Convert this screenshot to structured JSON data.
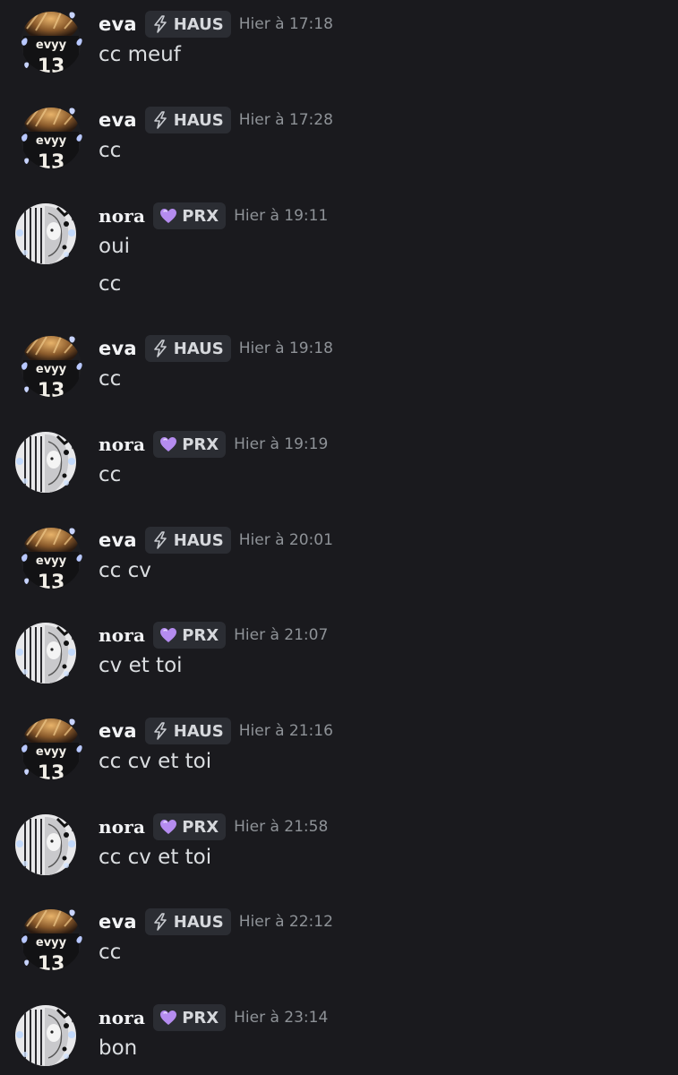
{
  "messages": [
    {
      "author": "eva",
      "avatar": "eva-avatar",
      "tag_icon": "lightning-icon",
      "tag": "HAUS",
      "time": "Hier à 17:18",
      "lines": [
        "cc meuf"
      ]
    },
    {
      "author": "eva",
      "avatar": "eva-avatar",
      "tag_icon": "lightning-icon",
      "tag": "HAUS",
      "time": "Hier à 17:28",
      "lines": [
        "cc"
      ]
    },
    {
      "author": "nora",
      "avatar": "nora-avatar",
      "tag_icon": "purple-heart-icon",
      "tag": "PRX",
      "time": "Hier à 19:11",
      "lines": [
        "oui",
        "cc"
      ]
    },
    {
      "author": "eva",
      "avatar": "eva-avatar",
      "tag_icon": "lightning-icon",
      "tag": "HAUS",
      "time": "Hier à 19:18",
      "lines": [
        "cc"
      ]
    },
    {
      "author": "nora",
      "avatar": "nora-avatar",
      "tag_icon": "purple-heart-icon",
      "tag": "PRX",
      "time": "Hier à 19:19",
      "lines": [
        "cc"
      ]
    },
    {
      "author": "eva",
      "avatar": "eva-avatar",
      "tag_icon": "lightning-icon",
      "tag": "HAUS",
      "time": "Hier à 20:01",
      "lines": [
        "cc cv"
      ]
    },
    {
      "author": "nora",
      "avatar": "nora-avatar",
      "tag_icon": "purple-heart-icon",
      "tag": "PRX",
      "time": "Hier à 21:07",
      "lines": [
        "cv et toi"
      ]
    },
    {
      "author": "eva",
      "avatar": "eva-avatar",
      "tag_icon": "lightning-icon",
      "tag": "HAUS",
      "time": "Hier à 21:16",
      "lines": [
        "cc cv et toi"
      ]
    },
    {
      "author": "nora",
      "avatar": "nora-avatar",
      "tag_icon": "purple-heart-icon",
      "tag": "PRX",
      "time": "Hier à 21:58",
      "lines": [
        "cc cv et toi"
      ]
    },
    {
      "author": "eva",
      "avatar": "eva-avatar",
      "tag_icon": "lightning-icon",
      "tag": "HAUS",
      "time": "Hier à 22:12",
      "lines": [
        "cc"
      ]
    },
    {
      "author": "nora",
      "avatar": "nora-avatar",
      "tag_icon": "purple-heart-icon",
      "tag": "PRX",
      "time": "Hier à 23:14",
      "lines": [
        "bon"
      ]
    }
  ],
  "avatar_text": {
    "eva": "evyy",
    "eva_number": "13"
  },
  "colors": {
    "background": "#1a1a1e",
    "username": "#f2f3f5",
    "timestamp": "#8e9297",
    "message_text": "#dbdee1",
    "tag_background": "#2b2d33",
    "heart": "#b58cf0"
  }
}
